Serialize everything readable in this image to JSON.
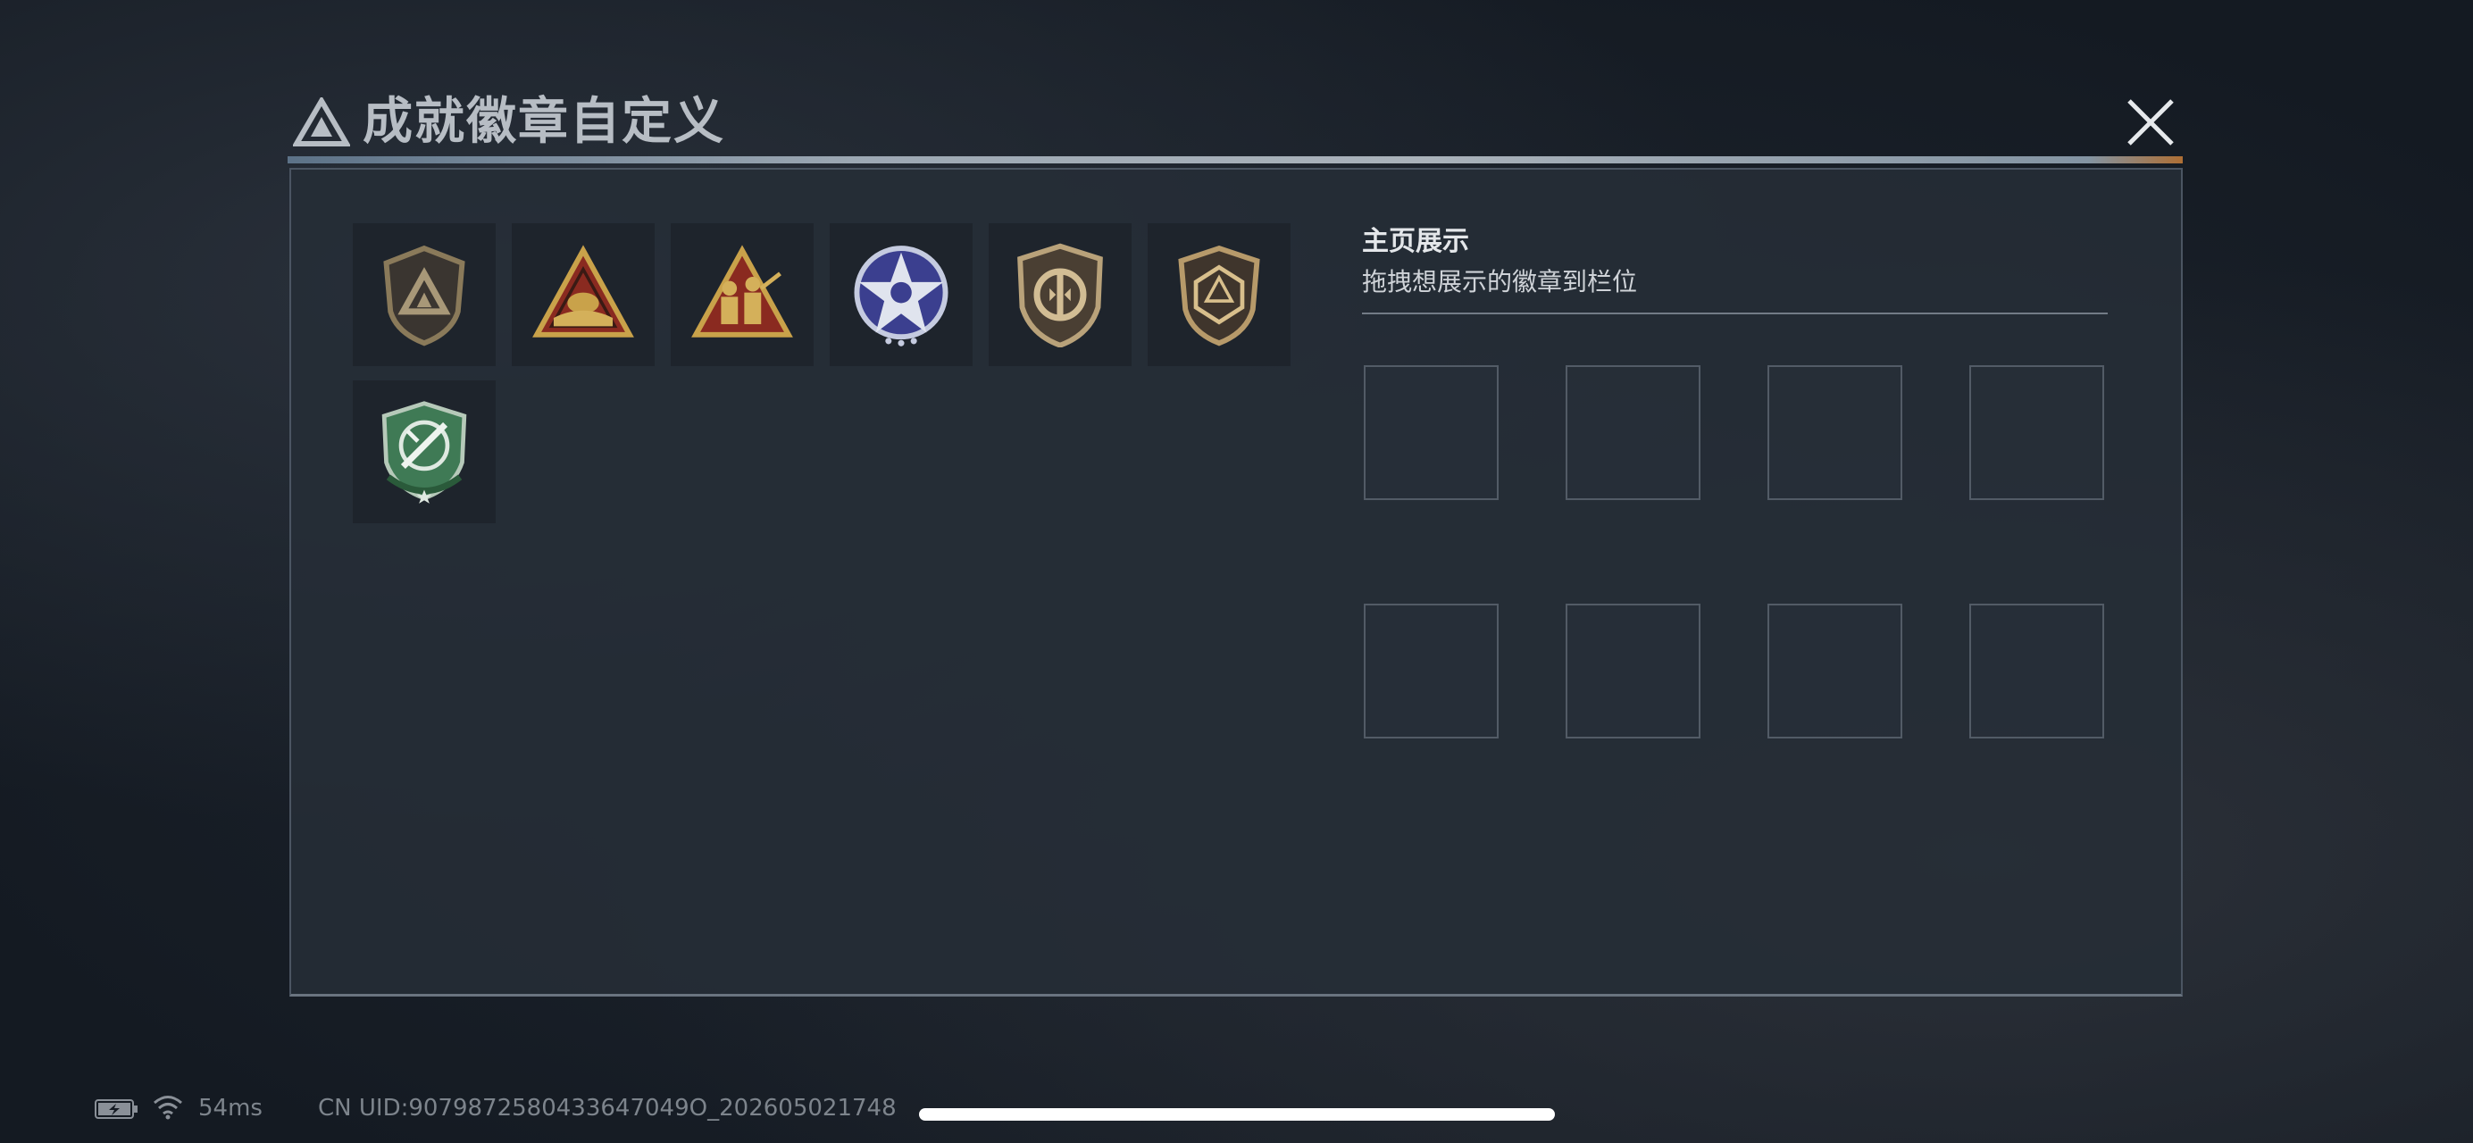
{
  "dialog": {
    "title": "成就徽章自定义",
    "logo_icon": "triangle-emblem-icon",
    "close_icon": "close-icon"
  },
  "badges": [
    {
      "icon": "shield-triangle-badge-icon",
      "colors": {
        "primary": "#8a7a5a",
        "accent": "#3a3530"
      }
    },
    {
      "icon": "triangle-hat-badge-icon",
      "colors": {
        "primary": "#c9a24a",
        "accent": "#8a2a20"
      }
    },
    {
      "icon": "triangle-soldiers-badge-icon",
      "colors": {
        "primary": "#c9a24a",
        "accent": "#8a2a20"
      }
    },
    {
      "icon": "star-eagle-badge-icon",
      "colors": {
        "primary": "#c5cbe0",
        "accent": "#3b3f8f"
      }
    },
    {
      "icon": "shield-circle-badge-icon",
      "colors": {
        "primary": "#b9a27a",
        "accent": "#4a3f33"
      }
    },
    {
      "icon": "shield-dice-badge-icon",
      "colors": {
        "primary": "#b79a6a",
        "accent": "#3f352c"
      }
    },
    {
      "icon": "green-knife-badge-icon",
      "colors": {
        "primary": "#3f7a55",
        "accent": "#b6c9b9"
      }
    }
  ],
  "display": {
    "title": "主页展示",
    "subtitle": "拖拽想展示的徽章到栏位",
    "slots": 8
  },
  "status_bar": {
    "ping": "54ms",
    "uid": "CN UID:9079872580433647049О_202605021748"
  }
}
